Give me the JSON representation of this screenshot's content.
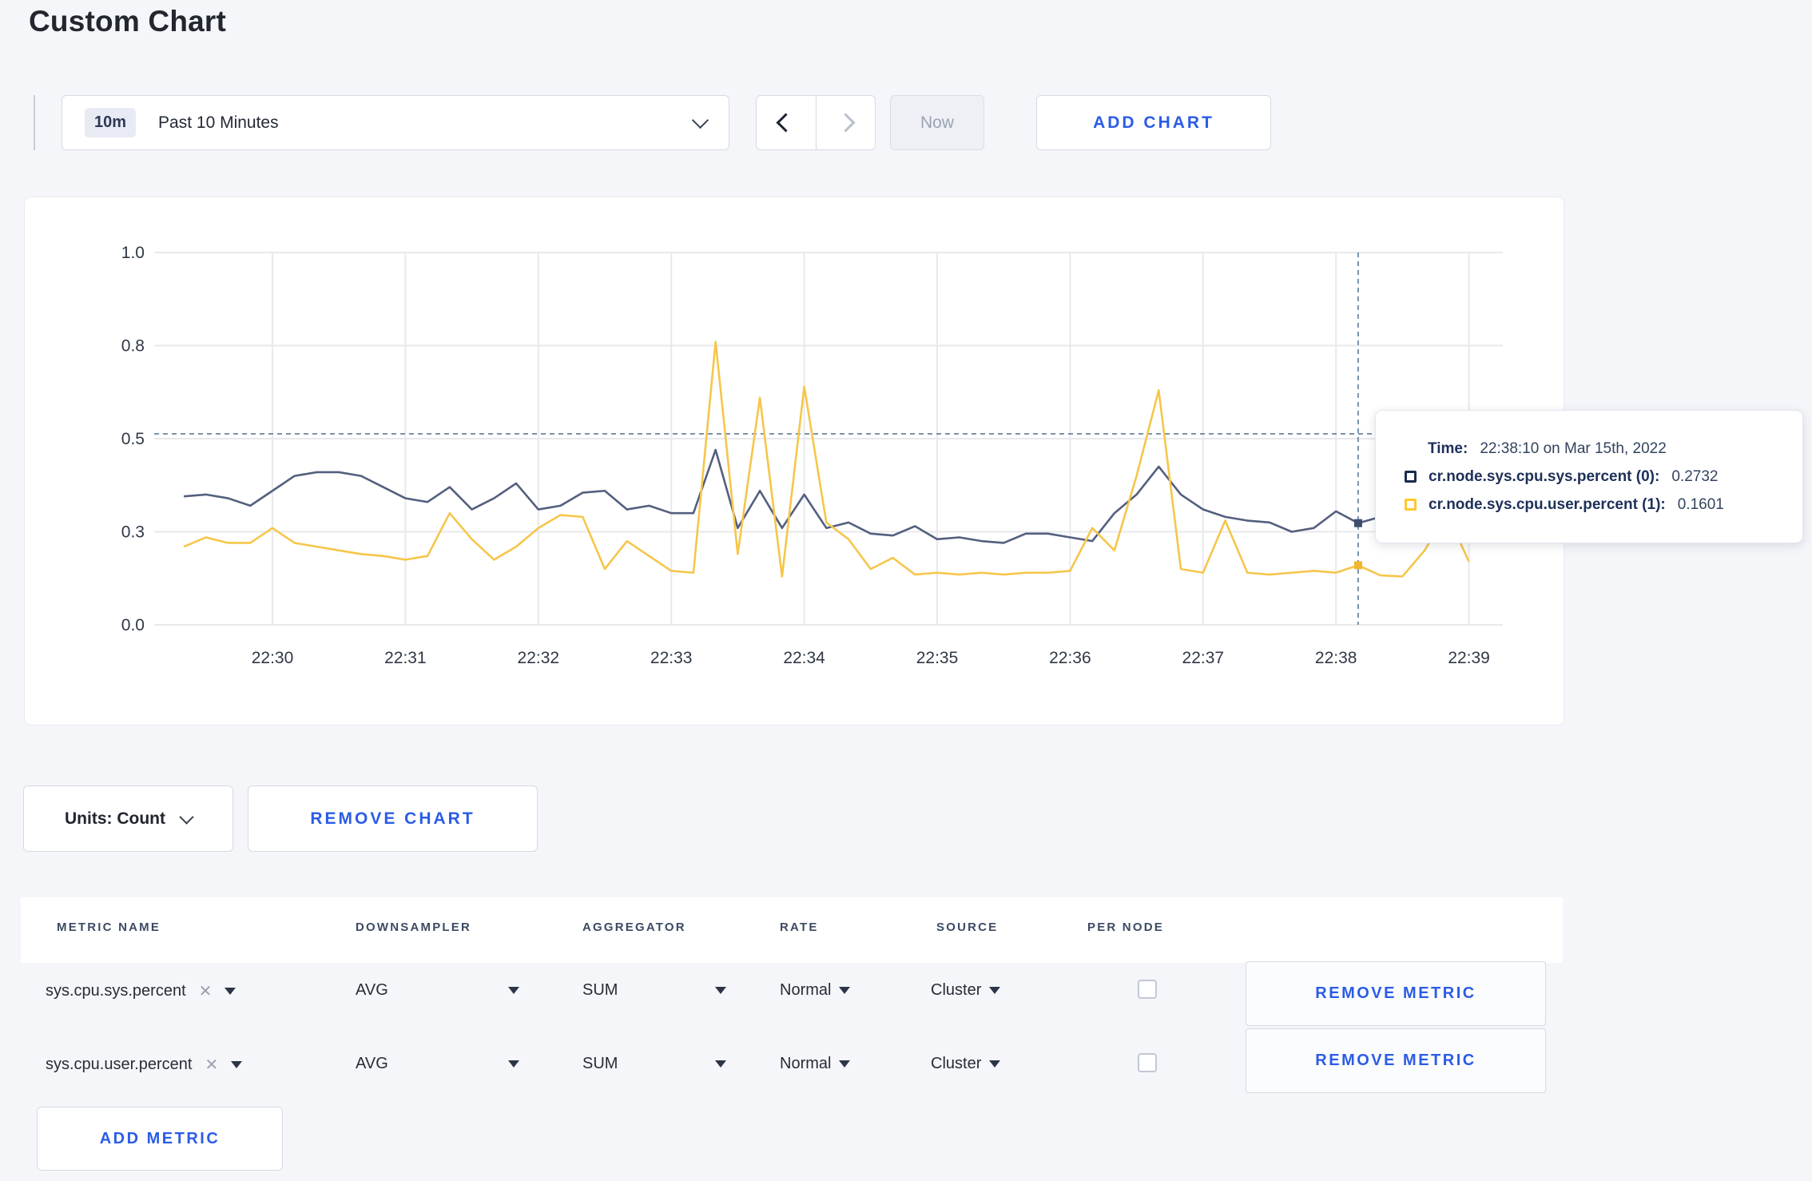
{
  "page": {
    "title": "Custom Chart"
  },
  "colors": {
    "accent_blue": "#2b5ce6",
    "series_sys": "#545f7e",
    "series_user": "#f6c64a",
    "swatch_sys": "#1b2b4a",
    "swatch_user": "#ffc72e",
    "gridline": "#e9e9ec",
    "crosshair": "#5d7a99"
  },
  "toolbar": {
    "time_range_badge": "10m",
    "time_range_label": "Past 10 Minutes",
    "now_label": "Now",
    "add_chart_label": "ADD CHART"
  },
  "chart_data": {
    "type": "line",
    "title": "",
    "xlabel": "",
    "ylabel": "",
    "ylim": [
      0,
      1.0
    ],
    "grid": true,
    "x_ticks": [
      "22:30",
      "22:31",
      "22:32",
      "22:33",
      "22:34",
      "22:35",
      "22:36",
      "22:37",
      "22:38",
      "22:39"
    ],
    "y_ticks": [
      {
        "label": "1.0",
        "value": 1.0
      },
      {
        "label": "0.8",
        "value": 0.75
      },
      {
        "label": "0.5",
        "value": 0.5
      },
      {
        "label": "0.3",
        "value": 0.25
      },
      {
        "label": "0.0",
        "value": 0.0
      }
    ],
    "x": [
      "22:29:20",
      "22:29:30",
      "22:29:40",
      "22:29:50",
      "22:30:00",
      "22:30:10",
      "22:30:20",
      "22:30:30",
      "22:30:40",
      "22:30:50",
      "22:31:00",
      "22:31:10",
      "22:31:20",
      "22:31:30",
      "22:31:40",
      "22:31:50",
      "22:32:00",
      "22:32:10",
      "22:32:20",
      "22:32:30",
      "22:32:40",
      "22:32:50",
      "22:33:00",
      "22:33:10",
      "22:33:20",
      "22:33:30",
      "22:33:40",
      "22:33:50",
      "22:34:00",
      "22:34:10",
      "22:34:20",
      "22:34:30",
      "22:34:40",
      "22:34:50",
      "22:35:00",
      "22:35:10",
      "22:35:20",
      "22:35:30",
      "22:35:40",
      "22:35:50",
      "22:36:00",
      "22:36:10",
      "22:36:20",
      "22:36:30",
      "22:36:40",
      "22:36:50",
      "22:37:00",
      "22:37:10",
      "22:37:20",
      "22:37:30",
      "22:37:40",
      "22:37:50",
      "22:38:00",
      "22:38:10",
      "22:38:20",
      "22:38:30",
      "22:38:40",
      "22:38:50",
      "22:39:00"
    ],
    "series": [
      {
        "name": "cr.node.sys.cpu.sys.percent",
        "values": [
          0.345,
          0.35,
          0.34,
          0.32,
          0.36,
          0.4,
          0.41,
          0.41,
          0.4,
          0.37,
          0.34,
          0.33,
          0.37,
          0.31,
          0.34,
          0.38,
          0.31,
          0.32,
          0.355,
          0.36,
          0.31,
          0.32,
          0.3,
          0.3,
          0.47,
          0.26,
          0.36,
          0.26,
          0.35,
          0.26,
          0.275,
          0.245,
          0.24,
          0.265,
          0.23,
          0.235,
          0.225,
          0.22,
          0.245,
          0.245,
          0.235,
          0.225,
          0.3,
          0.35,
          0.425,
          0.35,
          0.31,
          0.29,
          0.28,
          0.275,
          0.25,
          0.26,
          0.305,
          0.2732,
          0.29,
          0.28,
          0.29,
          0.3,
          0.3
        ]
      },
      {
        "name": "cr.node.sys.cpu.user.percent",
        "values": [
          0.21,
          0.235,
          0.22,
          0.22,
          0.26,
          0.22,
          0.21,
          0.2,
          0.19,
          0.185,
          0.175,
          0.185,
          0.3,
          0.23,
          0.175,
          0.21,
          0.26,
          0.295,
          0.29,
          0.15,
          0.225,
          0.185,
          0.145,
          0.14,
          0.76,
          0.19,
          0.61,
          0.13,
          0.64,
          0.275,
          0.23,
          0.15,
          0.18,
          0.135,
          0.14,
          0.135,
          0.14,
          0.135,
          0.14,
          0.14,
          0.145,
          0.26,
          0.2,
          0.4,
          0.63,
          0.15,
          0.14,
          0.28,
          0.14,
          0.135,
          0.14,
          0.145,
          0.14,
          0.1601,
          0.133,
          0.13,
          0.2,
          0.3,
          0.17
        ]
      }
    ],
    "crosshair": {
      "time": "22:38:10",
      "value_fraction": 0.513
    },
    "legend_position": "tooltip"
  },
  "tooltip": {
    "time_label": "Time:",
    "time_value": "22:38:10 on Mar 15th, 2022",
    "rows": [
      {
        "label": "cr.node.sys.cpu.sys.percent (0):",
        "value": "0.2732"
      },
      {
        "label": "cr.node.sys.cpu.user.percent (1):",
        "value": "0.1601"
      }
    ]
  },
  "chart_footer": {
    "units_label": "Units: Count",
    "remove_chart_label": "REMOVE CHART"
  },
  "metrics_table": {
    "headers": [
      "METRIC NAME",
      "DOWNSAMPLER",
      "AGGREGATOR",
      "RATE",
      "SOURCE",
      "PER NODE"
    ],
    "rows": [
      {
        "metric": "sys.cpu.sys.percent",
        "downsampler": "AVG",
        "aggregator": "SUM",
        "rate": "Normal",
        "source": "Cluster",
        "per_node": false,
        "remove_label": "REMOVE METRIC"
      },
      {
        "metric": "sys.cpu.user.percent",
        "downsampler": "AVG",
        "aggregator": "SUM",
        "rate": "Normal",
        "source": "Cluster",
        "per_node": false,
        "remove_label": "REMOVE METRIC"
      }
    ],
    "add_metric_label": "ADD METRIC"
  }
}
